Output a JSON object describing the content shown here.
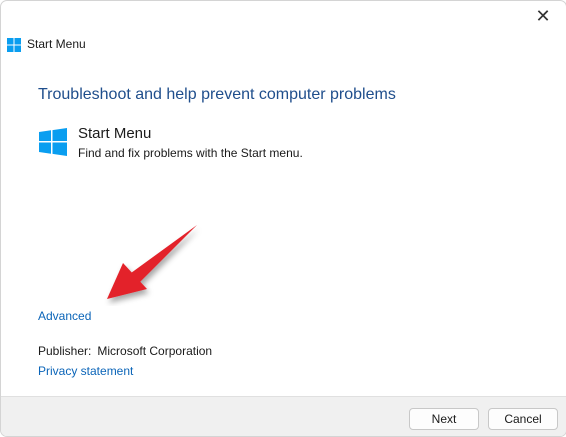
{
  "window": {
    "title": "Start Menu",
    "close_symbol": "✕",
    "icon": "windows-logo-icon"
  },
  "main": {
    "heading": "Troubleshoot and help prevent computer problems",
    "tool": {
      "name": "Start Menu",
      "description": "Find and fix problems with the Start menu.",
      "icon": "windows-logo-icon"
    },
    "advanced_link": "Advanced",
    "publisher": {
      "label": "Publisher:",
      "value": "Microsoft Corporation"
    },
    "privacy_link": "Privacy statement"
  },
  "footer": {
    "next_label": "Next",
    "cancel_label": "Cancel"
  },
  "colors": {
    "accent": "#1f4e8c",
    "link": "#0a64b8",
    "windows_blue": "#0a9ef0",
    "annotation_arrow": "#e3222a"
  }
}
